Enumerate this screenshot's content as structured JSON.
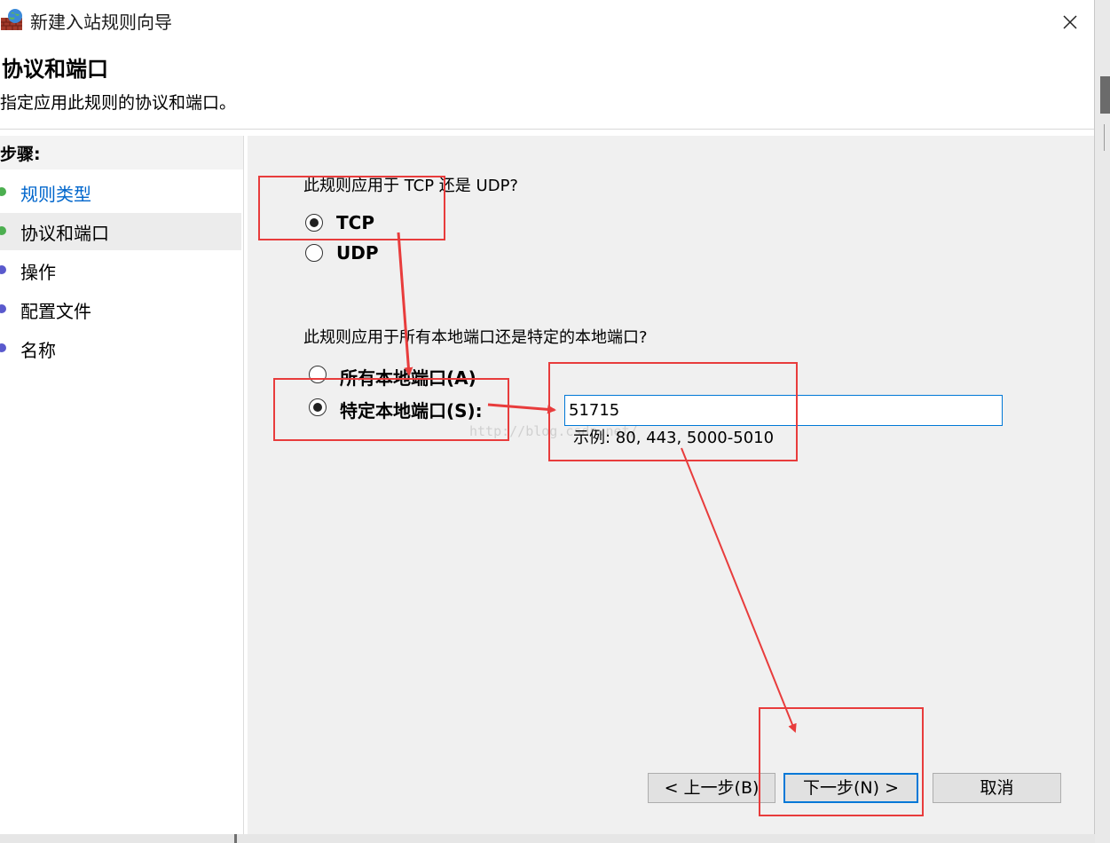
{
  "window": {
    "title": "新建入站规则向导",
    "close_icon": "close-icon"
  },
  "header": {
    "title": "协议和端口",
    "subtitle": "指定应用此规则的协议和端口。"
  },
  "steps": {
    "label": "步骤:",
    "items": [
      {
        "label": "规则类型",
        "state": "completed",
        "color": "#0066cc",
        "dot_color": "#4caf50"
      },
      {
        "label": "协议和端口",
        "state": "current",
        "color": "#000000",
        "dot_color": "#4caf50"
      },
      {
        "label": "操作",
        "state": "pending",
        "color": "#000000",
        "dot_color": "#5a5acd"
      },
      {
        "label": "配置文件",
        "state": "pending",
        "color": "#000000",
        "dot_color": "#5a5acd"
      },
      {
        "label": "名称",
        "state": "pending",
        "color": "#000000",
        "dot_color": "#5a5acd"
      }
    ]
  },
  "protocol": {
    "question": "此规则应用于 TCP 还是 UDP?",
    "options": [
      {
        "label": "TCP",
        "selected": true
      },
      {
        "label": "UDP",
        "selected": false
      }
    ]
  },
  "ports": {
    "question": "此规则应用于所有本地端口还是特定的本地端口?",
    "options": [
      {
        "label": "所有本地端口(A)",
        "selected": false
      },
      {
        "label": "特定本地端口(S):",
        "selected": true
      }
    ],
    "value": "51715",
    "example": "示例: 80, 443, 5000-5010"
  },
  "watermark": "http://blog.csdn.net/",
  "buttons": {
    "back": "< 上一步(B)",
    "next": "下一步(N) >",
    "cancel": "取消"
  },
  "annotation_color": "#e83c3c"
}
